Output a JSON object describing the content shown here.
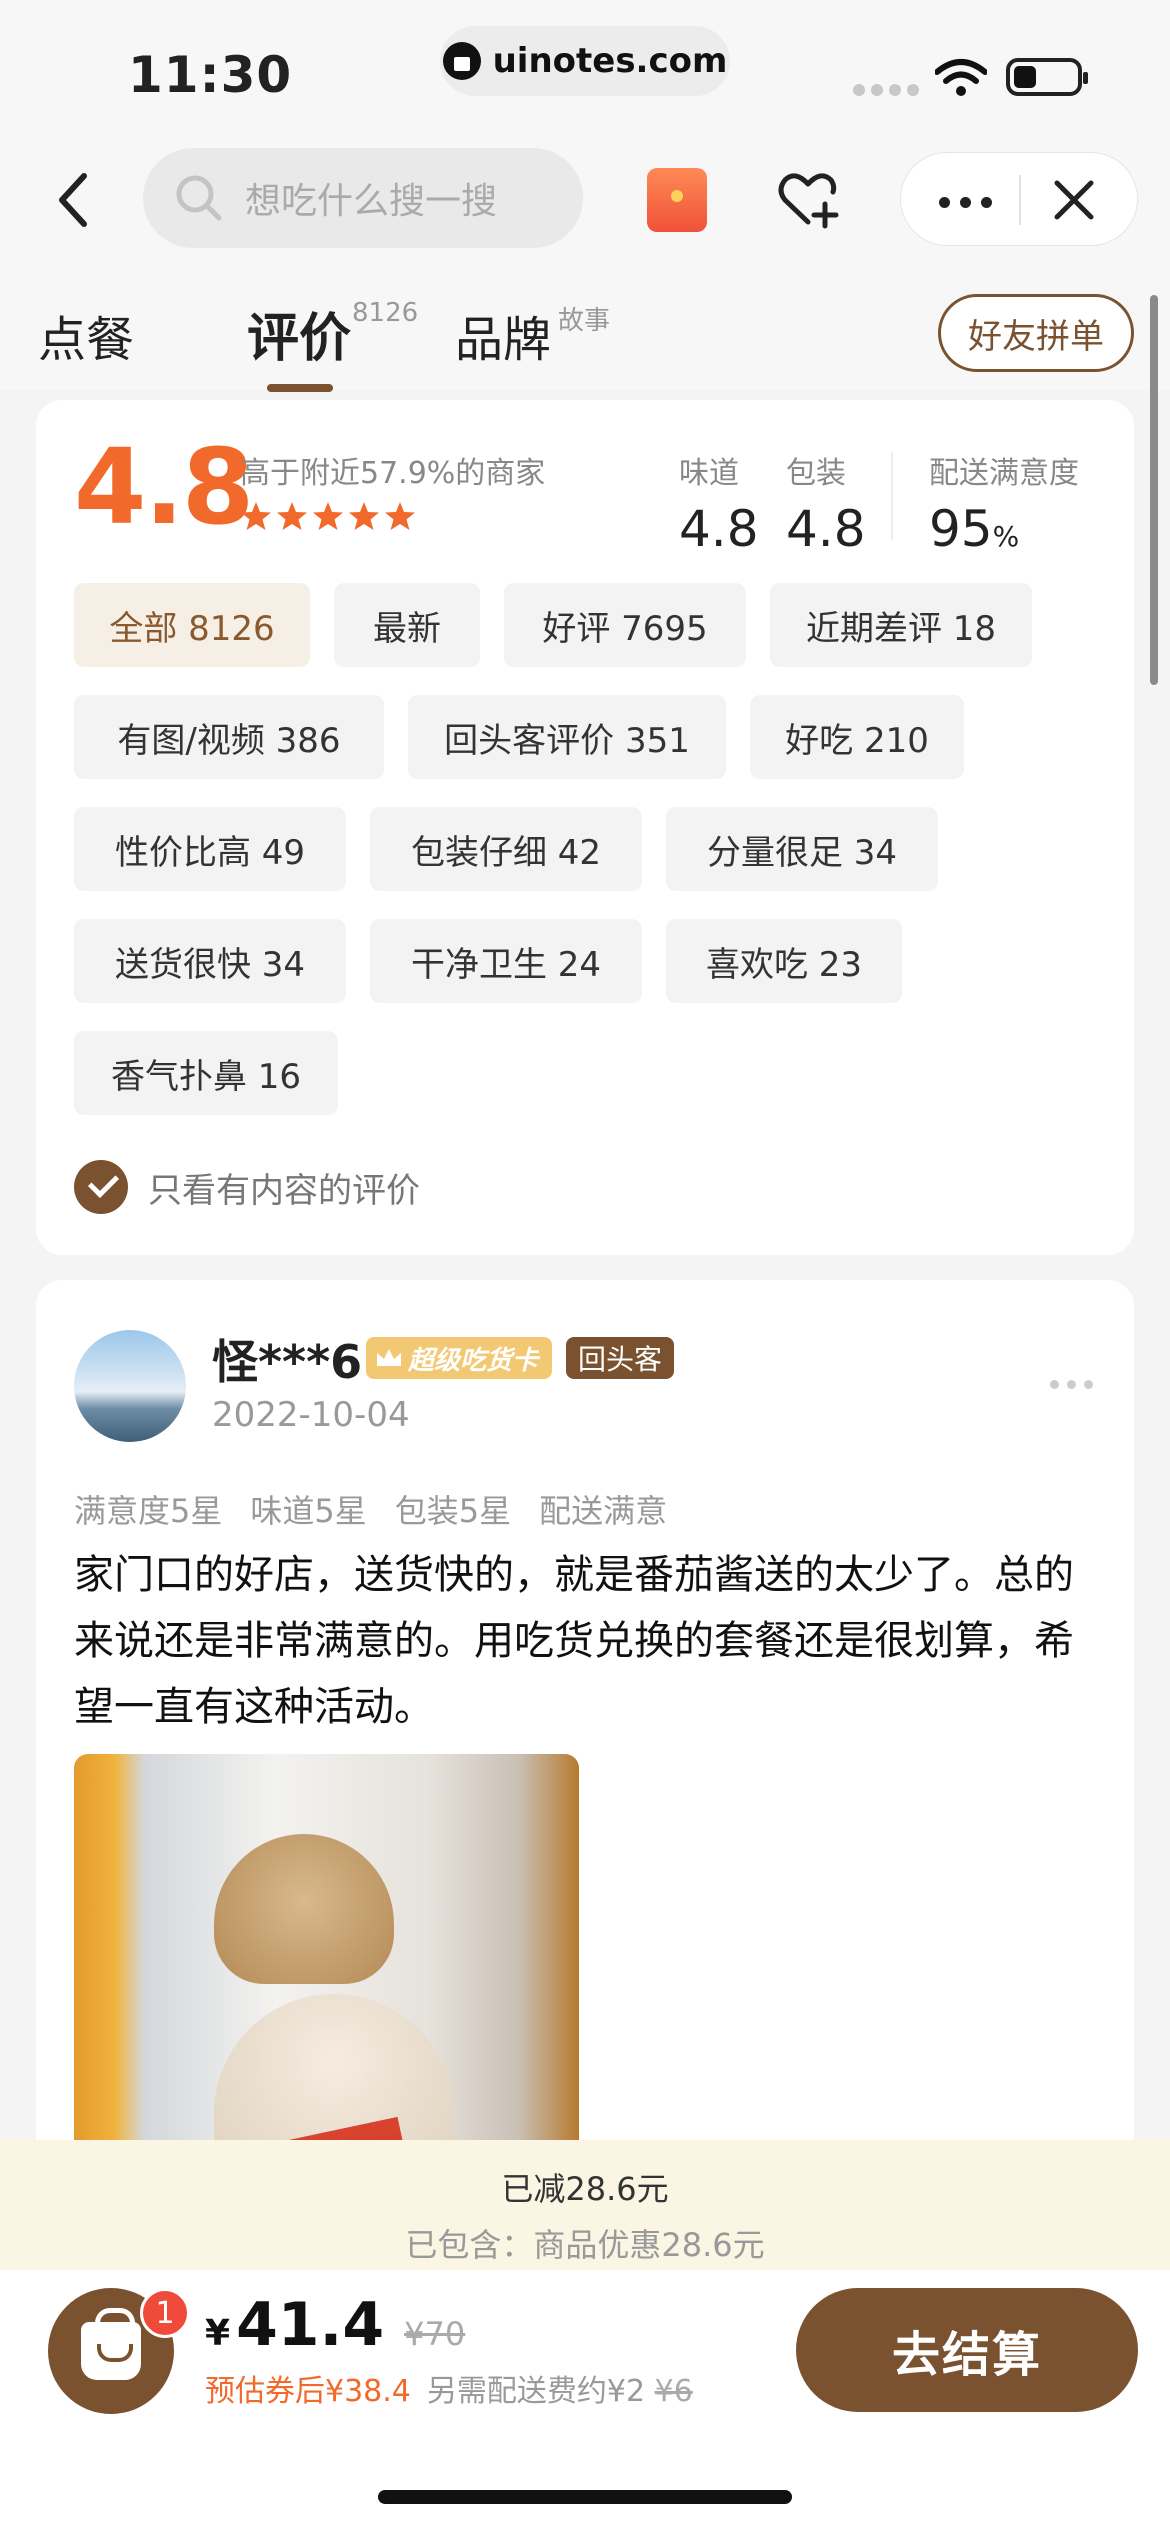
{
  "status_bar": {
    "time": "11:30",
    "url": "uinotes.com"
  },
  "nav": {
    "search_placeholder": "想吃什么搜一搜"
  },
  "tabs": {
    "order": "点餐",
    "review": "评价",
    "review_count": "8126",
    "brand": "品牌",
    "brand_sup": "故事",
    "group_order_button": "好友拼单"
  },
  "summary": {
    "score": "4.8",
    "compare_text": "高于附近57.9%的商家",
    "star_count": 5,
    "taste_label": "味道",
    "taste_value": "4.8",
    "pack_label": "包装",
    "pack_value": "4.8",
    "delivery_label": "配送满意度",
    "delivery_value": "95",
    "delivery_unit": "%"
  },
  "filters": [
    {
      "label": "全部 8126",
      "active": true
    },
    {
      "label": "最新"
    },
    {
      "label": "好评 7695"
    },
    {
      "label": "近期差评 18"
    },
    {
      "label": "有图/视频 386"
    },
    {
      "label": "回头客评价 351"
    },
    {
      "label": "好吃 210"
    },
    {
      "label": "性价比高 49"
    },
    {
      "label": "包装仔细 42"
    },
    {
      "label": "分量很足 34"
    },
    {
      "label": "送货很快 34"
    },
    {
      "label": "干净卫生 24"
    },
    {
      "label": "喜欢吃 23"
    },
    {
      "label": "香气扑鼻 16"
    }
  ],
  "only_content_label": "只看有内容的评价",
  "review": {
    "username": "怪***6",
    "vip_badge": "超级吃货卡",
    "returning_badge": "回头客",
    "date": "2022-10-04",
    "ratings": [
      "满意度5星",
      "味道5星",
      "包装5星",
      "配送满意"
    ],
    "text": "家门口的好店，送货快的，就是番茄酱送的太少了。总的来说还是非常满意的。用吃货兑换的套餐还是很划算，希望一直有这种活动。"
  },
  "promo": {
    "reduced": "已减28.6元",
    "detail": "已包含：商品优惠28.6元"
  },
  "bottom": {
    "cart_count": "1",
    "currency": "¥",
    "price": "41.4",
    "original_price": "¥70",
    "estimate": "预估券后¥38.4",
    "delivery_fee": "另需配送费约¥2",
    "delivery_fee_original": "¥6",
    "checkout_label": "去结算"
  },
  "colors": {
    "brand_brown": "#7a5230",
    "score_orange": "#f26a2b",
    "badge_red": "#f04a3a"
  }
}
